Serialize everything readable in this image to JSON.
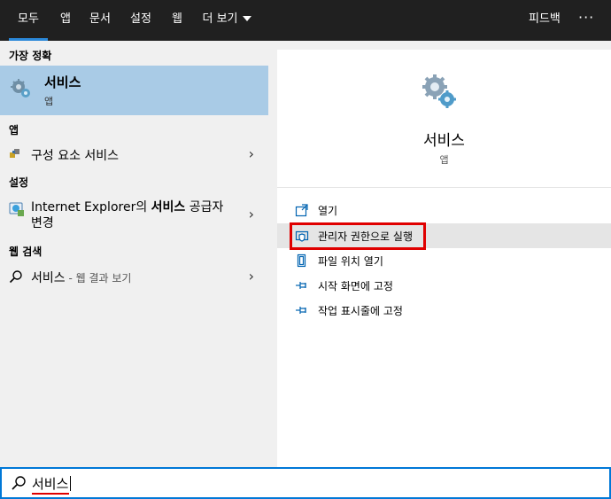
{
  "tabs": [
    {
      "label": "모두",
      "active": true
    },
    {
      "label": "앱"
    },
    {
      "label": "문서"
    },
    {
      "label": "설정"
    },
    {
      "label": "웹"
    },
    {
      "label": "더 보기"
    }
  ],
  "header": {
    "feedback": "피드백",
    "more": "···"
  },
  "left": {
    "best_match_heading": "가장 정확",
    "best_match": {
      "title": "서비스",
      "subtitle": "앱",
      "icon": "gears-icon"
    },
    "apps_heading": "앱",
    "apps_item": {
      "label": "구성 요소 서비스",
      "icon": "component-services-icon"
    },
    "settings_heading": "설정",
    "settings_item": {
      "label_line1_prefix": "Internet Explorer의 ",
      "label_line1_bold": "서비스",
      "label_line1_suffix": " 공급자",
      "label_line2": "변경",
      "icon": "internet-settings-icon"
    },
    "web_heading": "웹 검색",
    "web_item": {
      "label": "서비스",
      "suffix": " - 웹 결과 보기",
      "icon": "search-icon"
    }
  },
  "right": {
    "title": "서비스",
    "subtitle": "앱",
    "actions": [
      {
        "label": "열기",
        "icon": "open-icon"
      },
      {
        "label": "관리자 권한으로 실행",
        "icon": "shield-icon"
      },
      {
        "label": "파일 위치 열기",
        "icon": "file-location-icon"
      },
      {
        "label": "시작 화면에 고정",
        "icon": "pin-icon"
      },
      {
        "label": "작업 표시줄에 고정",
        "icon": "pin-icon"
      }
    ]
  },
  "search": {
    "value": "서비스"
  },
  "colors": {
    "accent": "#0078d7",
    "highlight": "#a9cbe6",
    "annotation": "#e00000"
  }
}
